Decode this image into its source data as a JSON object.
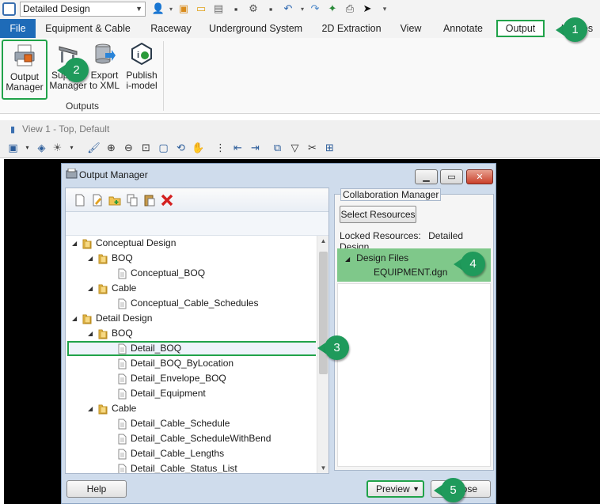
{
  "workspace_select": {
    "value": "Detailed Design"
  },
  "ribbon_tabs": [
    "File",
    "Equipment & Cable",
    "Raceway",
    "Underground System",
    "2D Extraction",
    "View",
    "Annotate",
    "Output",
    "Utilities"
  ],
  "ribbon": {
    "buttons": [
      {
        "line1": "Output",
        "line2": "Manager",
        "icon": "output-manager-icon"
      },
      {
        "line1": "Support",
        "line2": "Manager",
        "icon": "support-manager-icon"
      },
      {
        "line1": "Export",
        "line2": "to XML",
        "icon": "export-xml-icon"
      },
      {
        "line1": "Publish",
        "line2": "i-model",
        "icon": "publish-imodel-icon"
      }
    ],
    "group_label": "Outputs"
  },
  "view": {
    "title": "View 1 - Top, Default"
  },
  "dialog": {
    "title": "Output Manager",
    "tree": [
      {
        "label": "Conceptual Design",
        "level": 0,
        "expanded": true,
        "kind": "folder"
      },
      {
        "label": "BOQ",
        "level": 1,
        "expanded": true,
        "kind": "folder"
      },
      {
        "label": "Conceptual_BOQ",
        "level": 2,
        "kind": "doc"
      },
      {
        "label": "Cable",
        "level": 1,
        "expanded": true,
        "kind": "folder"
      },
      {
        "label": "Conceptual_Cable_Schedules",
        "level": 2,
        "kind": "doc"
      },
      {
        "label": "Detail Design",
        "level": 0,
        "expanded": true,
        "kind": "folder"
      },
      {
        "label": "BOQ",
        "level": 1,
        "expanded": true,
        "kind": "folder"
      },
      {
        "label": "Detail_BOQ",
        "level": 2,
        "kind": "doc",
        "selected": true
      },
      {
        "label": "Detail_BOQ_ByLocation",
        "level": 2,
        "kind": "doc"
      },
      {
        "label": "Detail_Envelope_BOQ",
        "level": 2,
        "kind": "doc"
      },
      {
        "label": "Detail_Equipment",
        "level": 2,
        "kind": "doc"
      },
      {
        "label": "Cable",
        "level": 1,
        "expanded": true,
        "kind": "folder"
      },
      {
        "label": "Detail_Cable_Schedule",
        "level": 2,
        "kind": "doc"
      },
      {
        "label": "Detail_Cable_ScheduleWithBend",
        "level": 2,
        "kind": "doc"
      },
      {
        "label": "Detail_Cable_Lengths",
        "level": 2,
        "kind": "doc"
      },
      {
        "label": "Detail_Cable_Status_List",
        "level": 2,
        "kind": "doc"
      }
    ],
    "collab": {
      "legend": "Collaboration Manager",
      "select_resources": "Select Resources",
      "locked_label": "Locked Resources:",
      "locked_value": "Detailed Design",
      "design_files_label": "Design Files",
      "file_name": "EQUIPMENT.dgn"
    },
    "help_button": "Help",
    "preview_button": "Preview",
    "close_button": "Close"
  },
  "callouts": [
    "1",
    "2",
    "3",
    "4",
    "5"
  ],
  "colors": {
    "file_tab": "#1e6bb8",
    "highlight_green": "#21a34a",
    "callout_green": "#1f9a5b",
    "design_files_bg": "#7fc88a",
    "view_bg": "#000000"
  }
}
